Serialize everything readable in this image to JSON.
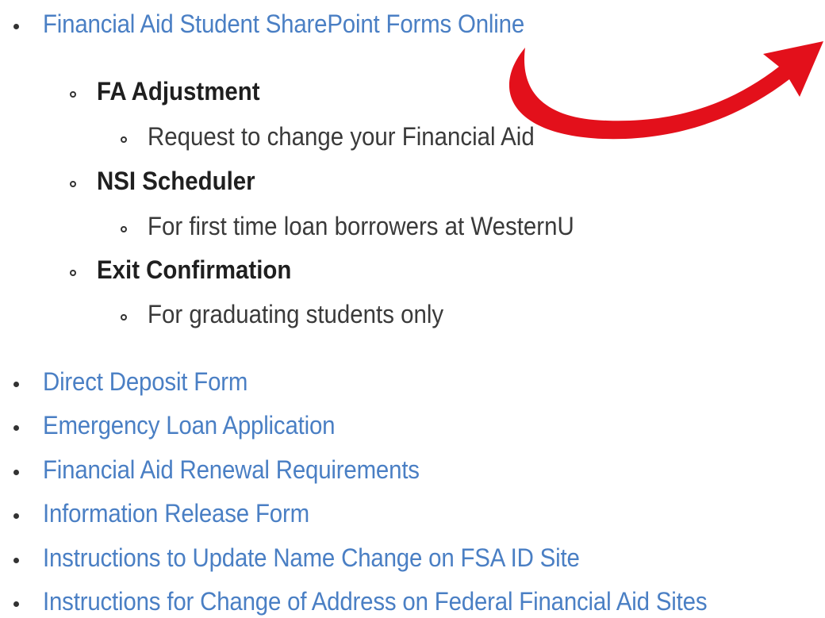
{
  "top_link": "Financial Aid Student SharePoint Forms Online",
  "subitems": [
    {
      "title": "FA Adjustment",
      "desc": "Request to change your Financial Aid"
    },
    {
      "title": "NSI Scheduler",
      "desc": "For first time loan borrowers at WesternU"
    },
    {
      "title": "Exit Confirmation",
      "desc": "For graduating students only"
    }
  ],
  "links": [
    "Direct Deposit Form",
    "Emergency Loan Application",
    "Financial Aid Renewal Requirements",
    "Information Release Form",
    "Instructions to Update Name Change on FSA ID Site",
    "Instructions for Change of Address on Federal Financial Aid Sites"
  ],
  "colors": {
    "link": "#4a7fc4",
    "arrow": "#e3101b",
    "text": "#333333"
  },
  "icons": {
    "annotation": "red-curved-arrow-icon",
    "bullet": "bullet-icon",
    "sub_bullet": "hollow-bullet-icon"
  }
}
